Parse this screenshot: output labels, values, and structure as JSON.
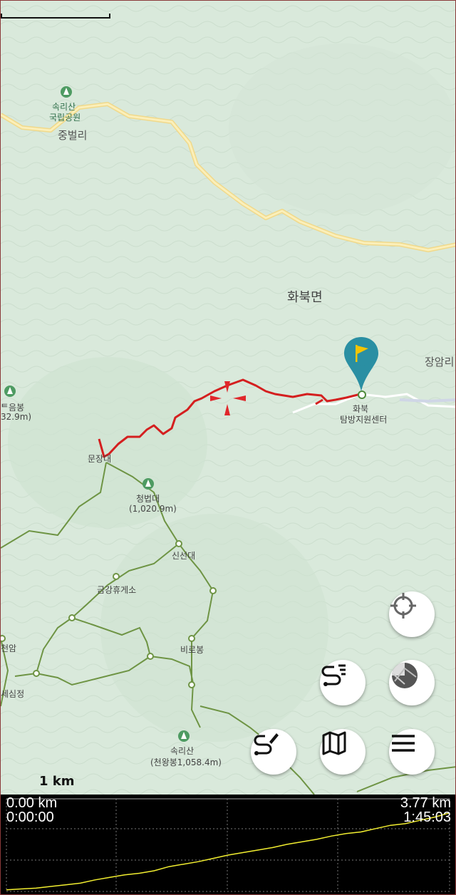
{
  "colors": {
    "track": "#d41f1f",
    "road": "#f6e39a",
    "trail": "#6c8f3f",
    "marker": "#2a8fa3",
    "flag": "#f5c400",
    "profile_bg": "#000000",
    "profile_line": "#f2ee30",
    "grid": "#777777"
  },
  "labels": {
    "park_name_1": "속리산",
    "park_name_2": "국립공원",
    "village_top": "중벌리",
    "township": "화북면",
    "village_right": "장암리",
    "peak_left_name": "ᄐ음봉",
    "peak_left_alt": "32.9m)",
    "munjangdae": "문장대",
    "cheongbeopdae_name": "청법대",
    "cheongbeopdae_alt": "(1,020.9m)",
    "sinseondae": "신선대",
    "geumgang": "금강휴게소",
    "birobong": "비로봉",
    "left_small_1": "천암",
    "left_small_2": "세심정",
    "songnisan_peak_name": "속리산",
    "songnisan_peak_alt": "(천왕봉1,058.4m)",
    "hwabuk_1": "화북",
    "hwabuk_2": "탐방지원센터"
  },
  "icons": {
    "marker": "flag-pin-icon",
    "locate": "crosshair-icon",
    "route": "route-list-icon",
    "layers": "map-layers-icon",
    "draw": "draw-route-icon",
    "map": "map-icon",
    "menu": "menu-icon",
    "peak": "mountain-icon"
  },
  "scale": {
    "label": "1 km"
  },
  "profile": {
    "start_distance": "0.00 km",
    "start_time": "0:00:00",
    "end_distance": "3.77 km",
    "end_time": "1:45:03",
    "elevation_fraction": [
      0.02,
      0.03,
      0.04,
      0.06,
      0.08,
      0.1,
      0.14,
      0.17,
      0.2,
      0.22,
      0.25,
      0.3,
      0.33,
      0.36,
      0.4,
      0.44,
      0.47,
      0.5,
      0.53,
      0.57,
      0.6,
      0.63,
      0.67,
      0.7,
      0.72,
      0.76,
      0.8,
      0.82,
      0.86,
      0.9,
      0.95
    ]
  }
}
